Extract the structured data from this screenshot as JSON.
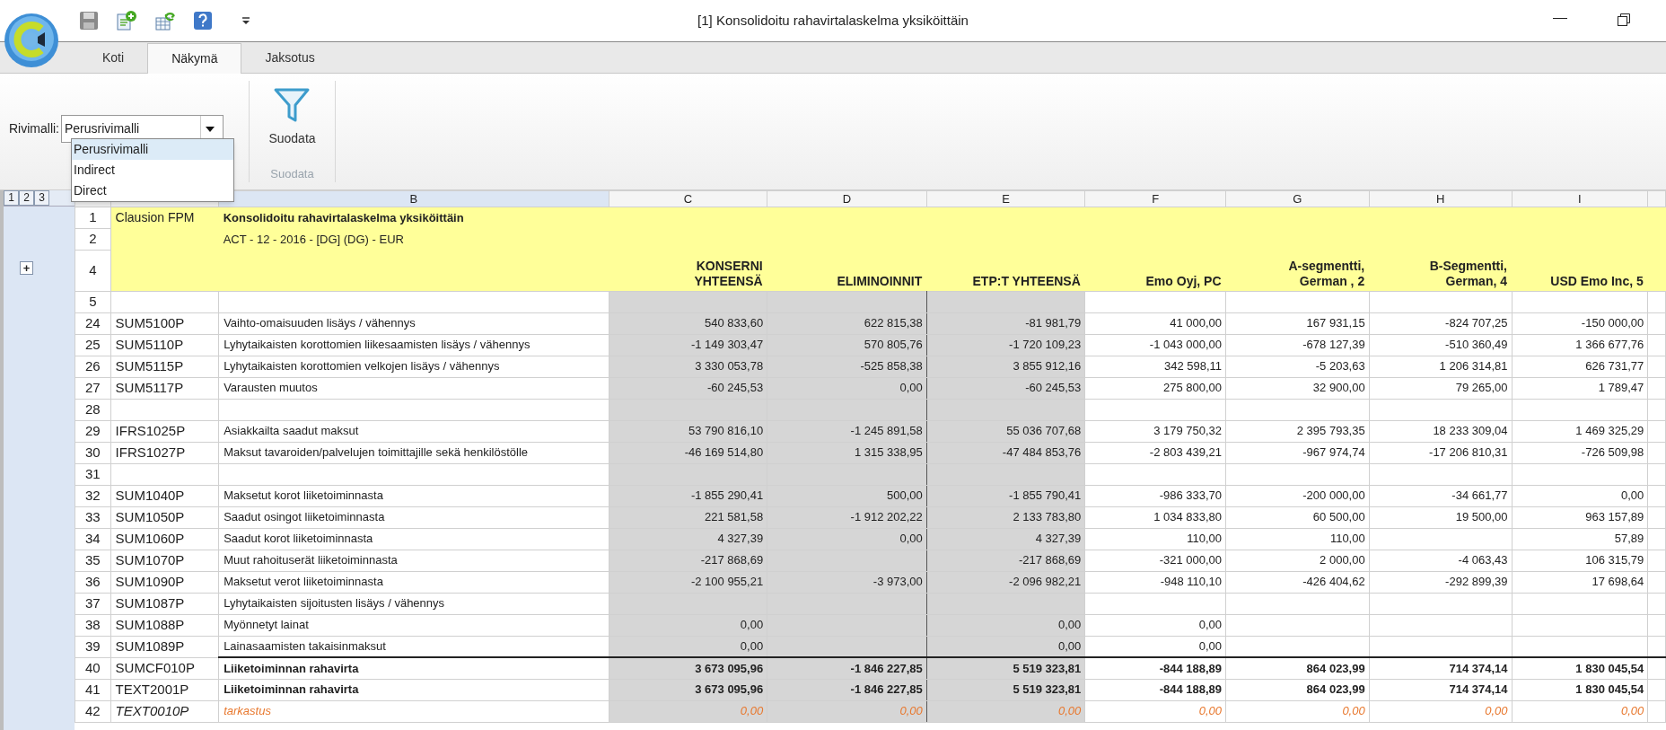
{
  "window": {
    "title": "[1] Konsolidoitu rahavirtalaskelma yksiköittäin"
  },
  "tabs": [
    {
      "label": "Koti",
      "selected": false
    },
    {
      "label": "Näkymä",
      "selected": true
    },
    {
      "label": "Jaksotus",
      "selected": false
    }
  ],
  "ribbon": {
    "row_model": {
      "label": "Rivimalli:",
      "value": "Perusrivimalli",
      "options": [
        {
          "label": "Perusrivimalli",
          "selected": true
        },
        {
          "label": "Indirect",
          "selected": false
        },
        {
          "label": "Direct",
          "selected": false
        }
      ]
    },
    "filter_button": "Suodata",
    "group_label": "Suodata"
  },
  "sheet": {
    "outline_levels": [
      "1",
      "2",
      "3"
    ],
    "expand_button": "+",
    "column_letters": [
      {
        "letter": "B",
        "selected": true
      },
      {
        "letter": "C",
        "selected": false
      },
      {
        "letter": "D",
        "selected": false
      },
      {
        "letter": "E",
        "selected": false
      },
      {
        "letter": "F",
        "selected": false
      },
      {
        "letter": "G",
        "selected": false
      },
      {
        "letter": "H",
        "selected": false
      },
      {
        "letter": "I",
        "selected": false
      }
    ],
    "title_row": {
      "num": "1",
      "code": "Clausion FPM",
      "label": "Konsolidoitu rahavirtalaskelma yksiköittäin"
    },
    "subtitle_row": {
      "num": "2",
      "label": "ACT - 12 - 2016 - [DG] (DG) - EUR"
    },
    "header_row": {
      "num": "4",
      "columns": [
        {
          "title": "KONSERNI\nYHTEENSÄ",
          "shaded": true
        },
        {
          "title": "ELIMINOINNIT",
          "shaded": true
        },
        {
          "title": "ETP:T YHTEENSÄ",
          "shaded": true
        },
        {
          "title": "Emo Oyj, PC",
          "shaded": false
        },
        {
          "title": "A-segmentti,\nGerman , 2",
          "shaded": false
        },
        {
          "title": "B-Segmentti,\nGerman, 4",
          "shaded": false
        },
        {
          "title": "USD Emo Inc, 5",
          "shaded": false
        }
      ]
    },
    "rows": [
      {
        "num": "5",
        "kind": "blank",
        "rule_above": false
      },
      {
        "num": "24",
        "kind": "data",
        "rule_above": false,
        "code": "SUM5100P",
        "label": "Vaihto-omaisuuden lisäys / vähennys",
        "values": {
          "c": "540 833,60",
          "d": "622 815,38",
          "e": "-81 981,79",
          "f": "41 000,00",
          "g": "167 931,15",
          "h": "-824 707,25",
          "i": "-150 000,00"
        }
      },
      {
        "num": "25",
        "kind": "data",
        "rule_above": false,
        "code": "SUM5110P",
        "label": "Lyhytaikaisten korottomien liikesaamisten lisäys / vähennys",
        "values": {
          "c": "-1 149 303,47",
          "d": "570 805,76",
          "e": "-1 720 109,23",
          "f": "-1 043 000,00",
          "g": "-678 127,39",
          "h": "-510 360,49",
          "i": "1 366 677,76"
        }
      },
      {
        "num": "26",
        "kind": "data",
        "rule_above": false,
        "code": "SUM5115P",
        "label": "Lyhytaikaisten korottomien velkojen lisäys / vähennys",
        "values": {
          "c": "3 330 053,78",
          "d": "-525 858,38",
          "e": "3 855 912,16",
          "f": "342 598,11",
          "g": "-5 203,63",
          "h": "1 206 314,81",
          "i": "626 731,77"
        }
      },
      {
        "num": "27",
        "kind": "data",
        "rule_above": false,
        "code": "SUM5117P",
        "label": "Varausten muutos",
        "values": {
          "c": "-60 245,53",
          "d": "0,00",
          "e": "-60 245,53",
          "f": "275 800,00",
          "g": "32 900,00",
          "h": "79 265,00",
          "i": "1 789,47"
        }
      },
      {
        "num": "28",
        "kind": "blank",
        "rule_above": false
      },
      {
        "num": "29",
        "kind": "data",
        "rule_above": false,
        "code": "IFRS1025P",
        "label": "Asiakkailta saadut maksut",
        "values": {
          "c": "53 790 816,10",
          "d": "-1 245 891,58",
          "e": "55 036 707,68",
          "f": "3 179 750,32",
          "g": "2 395 793,35",
          "h": "18 233 309,04",
          "i": "1 469 325,29"
        }
      },
      {
        "num": "30",
        "kind": "data",
        "rule_above": false,
        "code": "IFRS1027P",
        "label": "Maksut tavaroiden/palvelujen toimittajille sekä henkilöstölle",
        "values": {
          "c": "-46 169 514,80",
          "d": "1 315 338,95",
          "e": "-47 484 853,76",
          "f": "-2 803 439,21",
          "g": "-967 974,74",
          "h": "-17 206 810,31",
          "i": "-726 509,98"
        }
      },
      {
        "num": "31",
        "kind": "blank",
        "rule_above": false
      },
      {
        "num": "32",
        "kind": "data",
        "rule_above": false,
        "code": "SUM1040P",
        "label": "Maksetut korot liiketoiminnasta",
        "values": {
          "c": "-1 855 290,41",
          "d": "500,00",
          "e": "-1 855 790,41",
          "f": "-986 333,70",
          "g": "-200 000,00",
          "h": "-34 661,77",
          "i": "0,00"
        }
      },
      {
        "num": "33",
        "kind": "data",
        "rule_above": false,
        "code": "SUM1050P",
        "label": "Saadut osingot liiketoiminnasta",
        "values": {
          "c": "221 581,58",
          "d": "-1 912 202,22",
          "e": "2 133 783,80",
          "f": "1 034 833,80",
          "g": "60 500,00",
          "h": "19 500,00",
          "i": "963 157,89"
        }
      },
      {
        "num": "34",
        "kind": "data",
        "rule_above": false,
        "code": "SUM1060P",
        "label": "Saadut korot liiketoiminnasta",
        "values": {
          "c": "4 327,39",
          "d": "0,00",
          "e": "4 327,39",
          "f": "110,00",
          "g": "110,00",
          "i": "57,89"
        }
      },
      {
        "num": "35",
        "kind": "data",
        "rule_above": false,
        "code": "SUM1070P",
        "label": "Muut rahoituserät liiketoiminnasta",
        "values": {
          "c": "-217 868,69",
          "e": "-217 868,69",
          "f": "-321 000,00",
          "g": "2 000,00",
          "h": "-4 063,43",
          "i": "106 315,79"
        }
      },
      {
        "num": "36",
        "kind": "data",
        "rule_above": false,
        "code": "SUM1090P",
        "label": "Maksetut verot liiketoiminnasta",
        "values": {
          "c": "-2 100 955,21",
          "d": "-3 973,00",
          "e": "-2 096 982,21",
          "f": "-948 110,10",
          "g": "-426 404,62",
          "h": "-292 899,39",
          "i": "17 698,64"
        }
      },
      {
        "num": "37",
        "kind": "data",
        "rule_above": false,
        "code": "SUM1087P",
        "label": "Lyhytaikaisten sijoitusten lisäys / vähennys"
      },
      {
        "num": "38",
        "kind": "data",
        "rule_above": false,
        "code": "SUM1088P",
        "label": "Myönnetyt lainat",
        "values": {
          "c": "0,00",
          "e": "0,00",
          "f": "0,00"
        }
      },
      {
        "num": "39",
        "kind": "data",
        "rule_above": false,
        "code": "SUM1089P",
        "label": "Lainasaamisten takaisinmaksut",
        "values": {
          "c": "0,00",
          "e": "0,00",
          "f": "0,00"
        }
      },
      {
        "num": "40",
        "kind": "total",
        "rule_above": true,
        "code": "SUMCF010P",
        "label": "Liiketoiminnan rahavirta",
        "values": {
          "c": "3 673 095,96",
          "d": "-1 846 227,85",
          "e": "5 519 323,81",
          "f": "-844 188,89",
          "g": "864 023,99",
          "h": "714 374,14",
          "i": "1 830 045,54"
        }
      },
      {
        "num": "41",
        "kind": "total",
        "rule_above": false,
        "code": "TEXT2001P",
        "label": "Liiketoiminnan rahavirta",
        "values": {
          "c": "3 673 095,96",
          "d": "-1 846 227,85",
          "e": "5 519 323,81",
          "f": "-844 188,89",
          "g": "864 023,99",
          "h": "714 374,14",
          "i": "1 830 045,54"
        }
      },
      {
        "num": "42",
        "kind": "check",
        "rule_above": false,
        "code": "TEXT0010P",
        "label": "tarkastus",
        "values": {
          "c": "0,00",
          "d": "0,00",
          "e": "0,00",
          "f": "0,00",
          "g": "0,00",
          "h": "0,00",
          "i": "0,00"
        }
      }
    ]
  }
}
